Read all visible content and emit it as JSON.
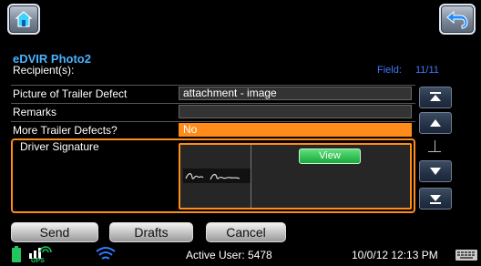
{
  "header": {
    "title": "eDVIR Photo2",
    "recipient_label": "Recipient(s):",
    "field_label": "Field:",
    "field_value": "11/11"
  },
  "form": {
    "rows": [
      {
        "label": "Picture of Trailer Defect",
        "value": "attachment - image"
      },
      {
        "label": "Remarks",
        "value": ""
      },
      {
        "label": "More Trailer Defects?",
        "value": "No"
      }
    ],
    "signature": {
      "label": "Driver Signature",
      "view_label": "View"
    }
  },
  "actions": {
    "send": "Send",
    "drafts": "Drafts",
    "cancel": "Cancel"
  },
  "status": {
    "gps_label": "GPS",
    "active_user": "Active User: 5478",
    "datetime": "10/0/12 12:13 PM"
  },
  "colors": {
    "accent_orange": "#ff8c1a",
    "title_blue": "#49b3ff",
    "field_blue": "#3f78ff",
    "battery_green": "#22c55e",
    "wifi_blue": "#2f7dff",
    "view_green": "#18a83c"
  },
  "icons": {
    "home": "home-icon",
    "back": "back-arrow-icon",
    "scroll_top": "scroll-top-icon",
    "scroll_up": "scroll-up-icon",
    "scroll_down": "scroll-down-icon",
    "scroll_bottom": "scroll-bottom-icon",
    "battery": "battery-icon",
    "antenna": "antenna-icon",
    "wifi": "wifi-icon",
    "keyboard": "keyboard-icon"
  }
}
